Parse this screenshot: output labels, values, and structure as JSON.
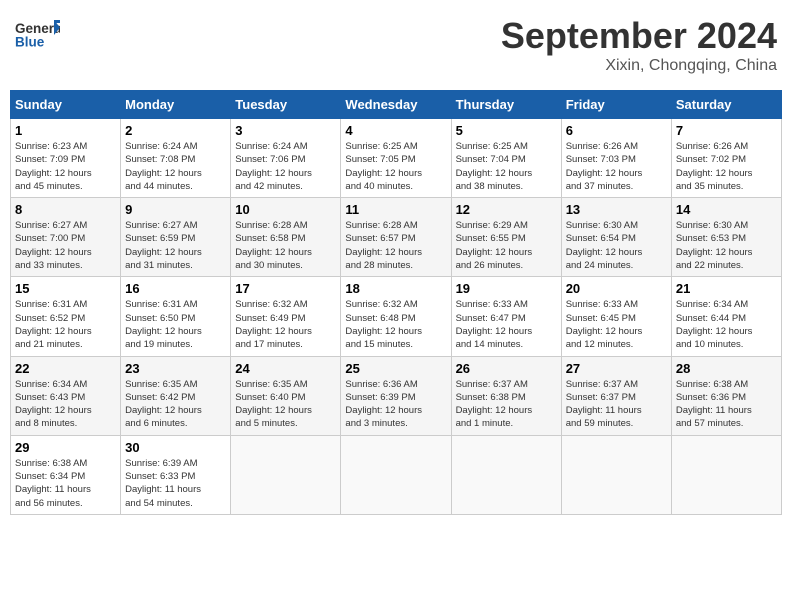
{
  "header": {
    "logo_line1": "General",
    "logo_line2": "Blue",
    "month": "September 2024",
    "location": "Xixin, Chongqing, China"
  },
  "weekdays": [
    "Sunday",
    "Monday",
    "Tuesday",
    "Wednesday",
    "Thursday",
    "Friday",
    "Saturday"
  ],
  "weeks": [
    [
      {
        "day": "1",
        "info": "Sunrise: 6:23 AM\nSunset: 7:09 PM\nDaylight: 12 hours\nand 45 minutes."
      },
      {
        "day": "2",
        "info": "Sunrise: 6:24 AM\nSunset: 7:08 PM\nDaylight: 12 hours\nand 44 minutes."
      },
      {
        "day": "3",
        "info": "Sunrise: 6:24 AM\nSunset: 7:06 PM\nDaylight: 12 hours\nand 42 minutes."
      },
      {
        "day": "4",
        "info": "Sunrise: 6:25 AM\nSunset: 7:05 PM\nDaylight: 12 hours\nand 40 minutes."
      },
      {
        "day": "5",
        "info": "Sunrise: 6:25 AM\nSunset: 7:04 PM\nDaylight: 12 hours\nand 38 minutes."
      },
      {
        "day": "6",
        "info": "Sunrise: 6:26 AM\nSunset: 7:03 PM\nDaylight: 12 hours\nand 37 minutes."
      },
      {
        "day": "7",
        "info": "Sunrise: 6:26 AM\nSunset: 7:02 PM\nDaylight: 12 hours\nand 35 minutes."
      }
    ],
    [
      {
        "day": "8",
        "info": "Sunrise: 6:27 AM\nSunset: 7:00 PM\nDaylight: 12 hours\nand 33 minutes."
      },
      {
        "day": "9",
        "info": "Sunrise: 6:27 AM\nSunset: 6:59 PM\nDaylight: 12 hours\nand 31 minutes."
      },
      {
        "day": "10",
        "info": "Sunrise: 6:28 AM\nSunset: 6:58 PM\nDaylight: 12 hours\nand 30 minutes."
      },
      {
        "day": "11",
        "info": "Sunrise: 6:28 AM\nSunset: 6:57 PM\nDaylight: 12 hours\nand 28 minutes."
      },
      {
        "day": "12",
        "info": "Sunrise: 6:29 AM\nSunset: 6:55 PM\nDaylight: 12 hours\nand 26 minutes."
      },
      {
        "day": "13",
        "info": "Sunrise: 6:30 AM\nSunset: 6:54 PM\nDaylight: 12 hours\nand 24 minutes."
      },
      {
        "day": "14",
        "info": "Sunrise: 6:30 AM\nSunset: 6:53 PM\nDaylight: 12 hours\nand 22 minutes."
      }
    ],
    [
      {
        "day": "15",
        "info": "Sunrise: 6:31 AM\nSunset: 6:52 PM\nDaylight: 12 hours\nand 21 minutes."
      },
      {
        "day": "16",
        "info": "Sunrise: 6:31 AM\nSunset: 6:50 PM\nDaylight: 12 hours\nand 19 minutes."
      },
      {
        "day": "17",
        "info": "Sunrise: 6:32 AM\nSunset: 6:49 PM\nDaylight: 12 hours\nand 17 minutes."
      },
      {
        "day": "18",
        "info": "Sunrise: 6:32 AM\nSunset: 6:48 PM\nDaylight: 12 hours\nand 15 minutes."
      },
      {
        "day": "19",
        "info": "Sunrise: 6:33 AM\nSunset: 6:47 PM\nDaylight: 12 hours\nand 14 minutes."
      },
      {
        "day": "20",
        "info": "Sunrise: 6:33 AM\nSunset: 6:45 PM\nDaylight: 12 hours\nand 12 minutes."
      },
      {
        "day": "21",
        "info": "Sunrise: 6:34 AM\nSunset: 6:44 PM\nDaylight: 12 hours\nand 10 minutes."
      }
    ],
    [
      {
        "day": "22",
        "info": "Sunrise: 6:34 AM\nSunset: 6:43 PM\nDaylight: 12 hours\nand 8 minutes."
      },
      {
        "day": "23",
        "info": "Sunrise: 6:35 AM\nSunset: 6:42 PM\nDaylight: 12 hours\nand 6 minutes."
      },
      {
        "day": "24",
        "info": "Sunrise: 6:35 AM\nSunset: 6:40 PM\nDaylight: 12 hours\nand 5 minutes."
      },
      {
        "day": "25",
        "info": "Sunrise: 6:36 AM\nSunset: 6:39 PM\nDaylight: 12 hours\nand 3 minutes."
      },
      {
        "day": "26",
        "info": "Sunrise: 6:37 AM\nSunset: 6:38 PM\nDaylight: 12 hours\nand 1 minute."
      },
      {
        "day": "27",
        "info": "Sunrise: 6:37 AM\nSunset: 6:37 PM\nDaylight: 11 hours\nand 59 minutes."
      },
      {
        "day": "28",
        "info": "Sunrise: 6:38 AM\nSunset: 6:36 PM\nDaylight: 11 hours\nand 57 minutes."
      }
    ],
    [
      {
        "day": "29",
        "info": "Sunrise: 6:38 AM\nSunset: 6:34 PM\nDaylight: 11 hours\nand 56 minutes."
      },
      {
        "day": "30",
        "info": "Sunrise: 6:39 AM\nSunset: 6:33 PM\nDaylight: 11 hours\nand 54 minutes."
      },
      {
        "day": "",
        "info": ""
      },
      {
        "day": "",
        "info": ""
      },
      {
        "day": "",
        "info": ""
      },
      {
        "day": "",
        "info": ""
      },
      {
        "day": "",
        "info": ""
      }
    ]
  ]
}
